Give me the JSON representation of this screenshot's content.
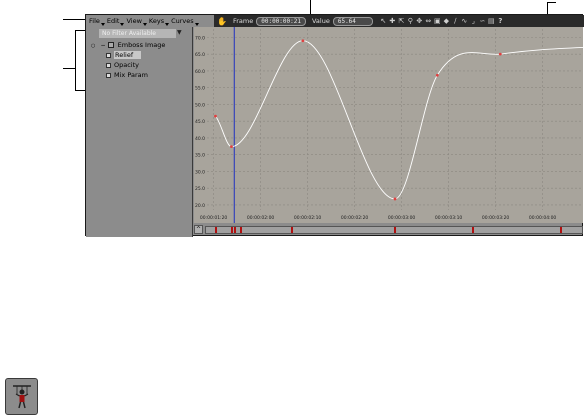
{
  "menubar": {
    "items": [
      "File",
      "Edit",
      "View",
      "Keys",
      "Curves"
    ]
  },
  "toolbar": {
    "frame_label": "Frame",
    "frame_value": "00:00:00:21",
    "value_label": "Value",
    "value_value": "65.64",
    "tool_icons": [
      "select-icon",
      "move-icon",
      "scale-icon",
      "zoom-icon",
      "pan-icon",
      "fit-icon",
      "frame-all-icon",
      "key-icon",
      "linear-icon",
      "bezier-icon",
      "step-icon",
      "ease-icon",
      "snap-icon",
      "help-icon"
    ]
  },
  "outliner": {
    "filter": "No Filter Available",
    "filter_arrow": "▼",
    "node_label": "Emboss Image",
    "params": [
      "Relief",
      "Opacity",
      "Mix Param"
    ]
  },
  "chart_data": {
    "type": "line",
    "y_ticks": [
      "70.0",
      "65.0",
      "60.0",
      "55.0",
      "50.0",
      "45.0",
      "40.0",
      "35.0",
      "30.0",
      "25.0",
      "20.0"
    ],
    "x_ticks": [
      "00:00:01:20",
      "00:00:02:00",
      "00:00:02:10",
      "00:00:02:20",
      "00:00:03:00",
      "00:00:03:10",
      "00:00:03:20",
      "00:00:04:00"
    ],
    "ylim": [
      18.5,
      72.5
    ],
    "keyframes": [
      [
        0.2,
        46.5
      ],
      [
        1.9,
        37.4
      ],
      [
        9.5,
        69.0
      ],
      [
        19.3,
        21.8
      ],
      [
        23.8,
        58.7
      ],
      [
        30.5,
        65.0
      ]
    ],
    "current_frame_marker": 2.2,
    "colors": {
      "curve": "#ffffff",
      "key": "#e04040",
      "cursor": "#2030c0",
      "grid": "#8a8780"
    }
  },
  "timeline": {
    "toggle": "^",
    "keys": [
      1.5,
      4.0,
      4.5,
      5.4,
      13.5,
      30.0,
      42.5,
      56.5
    ]
  }
}
